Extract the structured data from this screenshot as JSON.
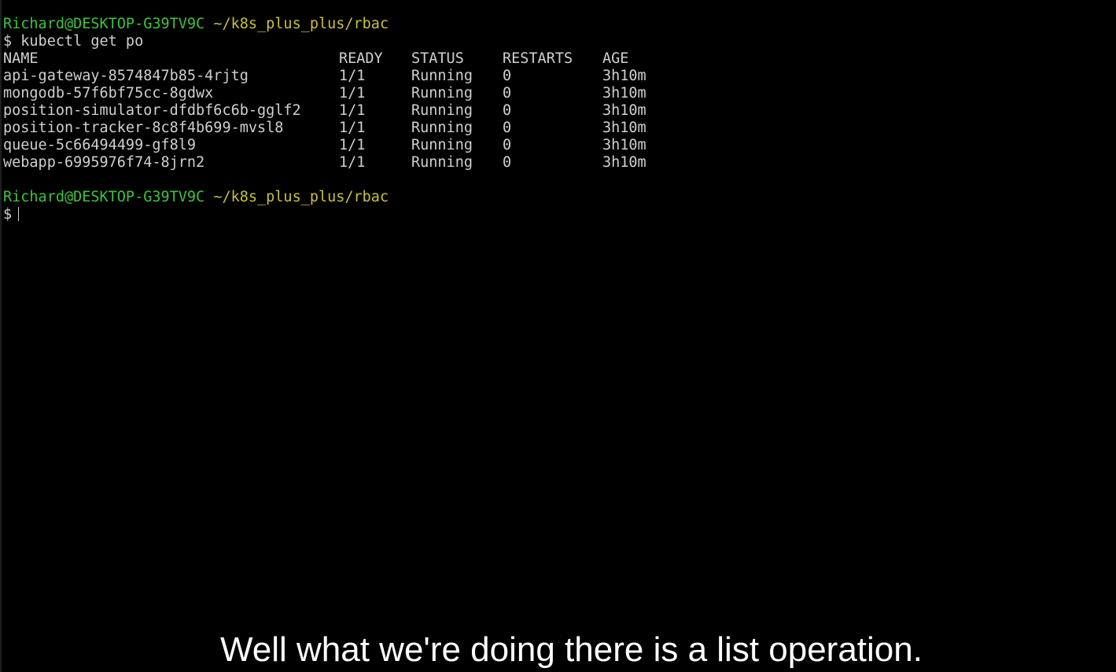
{
  "terminal": {
    "prompt1": {
      "user_host": "Richard@DESKTOP-G39TV9C",
      "path": "~/k8s_plus_plus/rbac"
    },
    "command_line": "$ kubectl get po",
    "table": {
      "headers": [
        "NAME",
        "READY",
        "STATUS",
        "RESTARTS",
        "AGE"
      ],
      "rows": [
        [
          "api-gateway-8574847b85-4rjtg",
          "1/1",
          "Running",
          "0",
          "3h10m"
        ],
        [
          "mongodb-57f6bf75cc-8gdwx",
          "1/1",
          "Running",
          "0",
          "3h10m"
        ],
        [
          "position-simulator-dfdbf6c6b-gglf2",
          "1/1",
          "Running",
          "0",
          "3h10m"
        ],
        [
          "position-tracker-8c8f4b699-mvsl8",
          "1/1",
          "Running",
          "0",
          "3h10m"
        ],
        [
          "queue-5c66494499-gf8l9",
          "1/1",
          "Running",
          "0",
          "3h10m"
        ],
        [
          "webapp-6995976f74-8jrn2",
          "1/1",
          "Running",
          "0",
          "3h10m"
        ]
      ]
    },
    "prompt2": {
      "user_host": "Richard@DESKTOP-G39TV9C",
      "path": "~/k8s_plus_plus/rbac"
    },
    "input_prompt": "$"
  },
  "caption": "Well what we're doing there is a list operation.",
  "colors": {
    "user_host": "#3cc33c",
    "path": "#c8c13a",
    "text": "#cfcfcf",
    "background": "#000000",
    "caption": "#ffffff"
  }
}
